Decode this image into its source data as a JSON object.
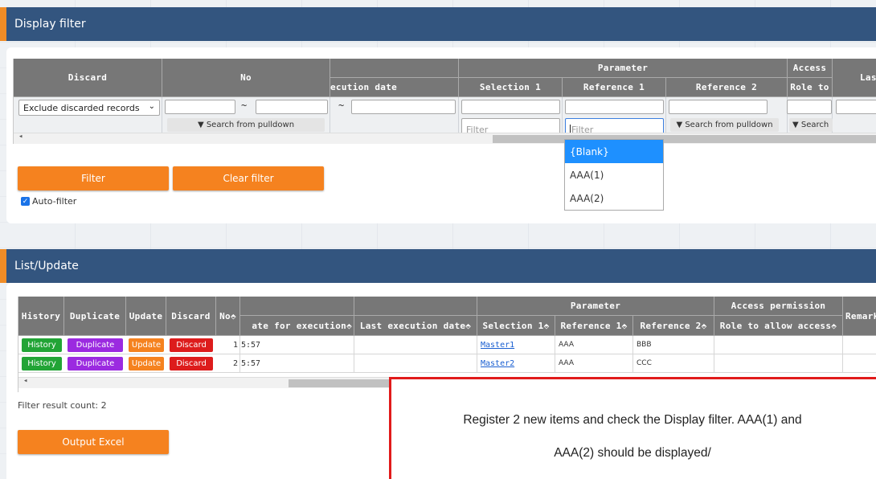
{
  "filter_section": {
    "title": "Display filter",
    "headers": {
      "discard": "Discard",
      "no": "No",
      "exec_date": "ecution date",
      "parameter": "Parameter",
      "selection1": "Selection 1",
      "reference1": "Reference 1",
      "reference2": "Reference 2",
      "access": "Access",
      "role_to": "Role to",
      "last": "Las"
    },
    "discard_select_value": "Exclude discarded records",
    "tilde": "~",
    "search_from_pulldown": "▼ Search from pulldown",
    "search_trunc": "▼ Search",
    "filter_placeholder": "Filter",
    "dropdown_options": [
      "{Blank}",
      "AAA(1)",
      "AAA(2)"
    ],
    "filter_button": "Filter",
    "clear_filter_button": "Clear filter",
    "auto_filter_label": "Auto-filter",
    "auto_filter_checked": true,
    "scroll_left_arrow": "◂"
  },
  "list_section": {
    "title": "List/Update",
    "headers": {
      "history": "History",
      "duplicate": "Duplicate",
      "update": "Update",
      "discard": "Discard",
      "no": "No",
      "date_exec": "ate for execution",
      "last_exec": "Last execution date",
      "parameter": "Parameter",
      "selection1": "Selection 1",
      "reference1": "Reference 1",
      "reference2": "Reference 2",
      "access_permission": "Access permission",
      "role_allow": "Role to allow access",
      "remarks": "Remark"
    },
    "sort_icon": "⬘",
    "row_buttons": {
      "history": "History",
      "duplicate": "Duplicate",
      "update": "Update",
      "discard": "Discard"
    },
    "rows": [
      {
        "no_time": "1",
        "time": "5:57",
        "selection1": "Master1",
        "reference1": "AAA",
        "reference2": "BBB"
      },
      {
        "no_time": "2",
        "time": "5:57",
        "selection1": "Master2",
        "reference1": "AAA",
        "reference2": "CCC"
      }
    ],
    "filter_result_count": "Filter result count: 2",
    "output_excel_button": "Output Excel",
    "scroll_left_arrow": "◂"
  },
  "callout": {
    "line1": "Register 2 new items and check the Display filter. AAA(1) and",
    "line2": "AAA(2) should be displayed/"
  },
  "colors": {
    "header_bg": "#33557f",
    "accent": "#f5821f",
    "history_btn": "#22a436",
    "duplicate_btn": "#9b2ae0",
    "update_btn": "#f5821f",
    "discard_btn": "#dd1c1c",
    "callout_border": "#e11b1b",
    "dropdown_selected": "#1e90ff"
  }
}
